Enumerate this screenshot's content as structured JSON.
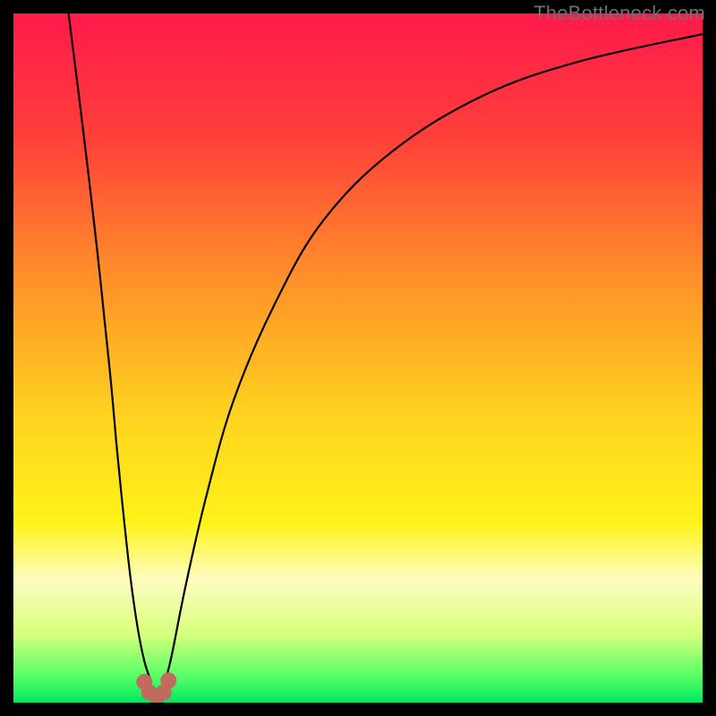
{
  "watermark": "TheBottleneck.com",
  "chart_data": {
    "type": "line",
    "title": "",
    "xlabel": "",
    "ylabel": "",
    "xlim": [
      0,
      100
    ],
    "ylim": [
      0,
      100
    ],
    "series": [
      {
        "name": "bottleneck-curve-left",
        "x": [
          8,
          10,
          12,
          14,
          15,
          16,
          17,
          18,
          19,
          20
        ],
        "values": [
          100,
          84,
          67,
          48,
          37,
          27,
          18,
          11,
          6,
          3
        ]
      },
      {
        "name": "bottleneck-curve-right",
        "x": [
          22,
          23,
          25,
          28,
          32,
          38,
          45,
          55,
          68,
          82,
          100
        ],
        "values": [
          3,
          7,
          17,
          30,
          44,
          58,
          70,
          80,
          88,
          93,
          97
        ]
      }
    ],
    "markers": {
      "name": "optimal-region",
      "color": "#c16a5e",
      "points": [
        {
          "x": 19.0,
          "y": 3.0
        },
        {
          "x": 19.7,
          "y": 1.5
        },
        {
          "x": 20.8,
          "y": 0.9
        },
        {
          "x": 21.8,
          "y": 1.5
        },
        {
          "x": 22.5,
          "y": 3.2
        }
      ]
    },
    "background_gradient": [
      {
        "stop": 0.0,
        "color": "#ff1a4b"
      },
      {
        "stop": 0.18,
        "color": "#ff3f3a"
      },
      {
        "stop": 0.38,
        "color": "#ff8f2a"
      },
      {
        "stop": 0.58,
        "color": "#ffd21f"
      },
      {
        "stop": 0.74,
        "color": "#fff31a"
      },
      {
        "stop": 0.82,
        "color": "#fffdc0"
      },
      {
        "stop": 0.9,
        "color": "#d7ff7e"
      },
      {
        "stop": 0.96,
        "color": "#5bff68"
      },
      {
        "stop": 1.0,
        "color": "#00e860"
      }
    ]
  }
}
